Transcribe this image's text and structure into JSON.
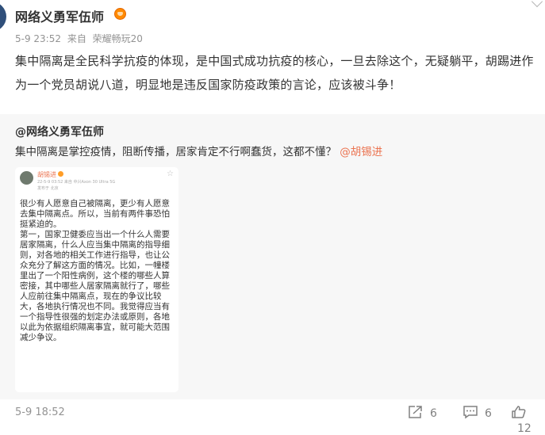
{
  "post": {
    "author": "网络义勇军伍师",
    "timestamp": "5-9 23:52",
    "source_prefix": "来自",
    "source_device": "荣耀畅玩20",
    "text": "集中隔离是全民科学抗疫的体现，是中国式成功抗疫的核心，一旦去除这个，无疑躺平，胡踢进作为一个党员胡说八道，明显地是违反国家防疫政策的言论，应该被斗争！"
  },
  "repost": {
    "author": "@网络义勇军伍师",
    "text": "集中隔离是掌控疫情，阻断传播，居家肯定不行啊蠢货，这都不懂？",
    "mention": "@胡锡进",
    "image": {
      "author": "胡锡进",
      "meta": "22-5-9 03:52  来自 中兴Axon 30 Ultra 5G",
      "meta2": "发布于 北京",
      "body": "很少有人愿意自己被隔离，更少有人愿意去集中隔离点。所以，当前有两件事恐怕挺紧迫的。\n第一，国家卫健委应当出一个什么人需要居家隔离，什么人应当集中隔离的指导细则，对各地的相关工作进行指导，也让公众充分了解这方面的情况。比如，一幢楼里出了一个阳性病例，这个楼的哪些人算密接，其中哪些人居家隔离就行了，哪些人应前往集中隔离点，现在的争议比较大，各地执行情况也不同。我觉得应当有一个指导性很强的划定办法或原则，各地以此为依据组织隔离事宜，就可能大范围减少争议。"
    }
  },
  "footer": {
    "time": "5-9 18:52",
    "repost_count": "6",
    "comment_count": "6",
    "like_count": "12"
  },
  "colors": {
    "mention": "#eb7350",
    "meta": "#939393",
    "repost_bg": "#f7f7f7"
  }
}
